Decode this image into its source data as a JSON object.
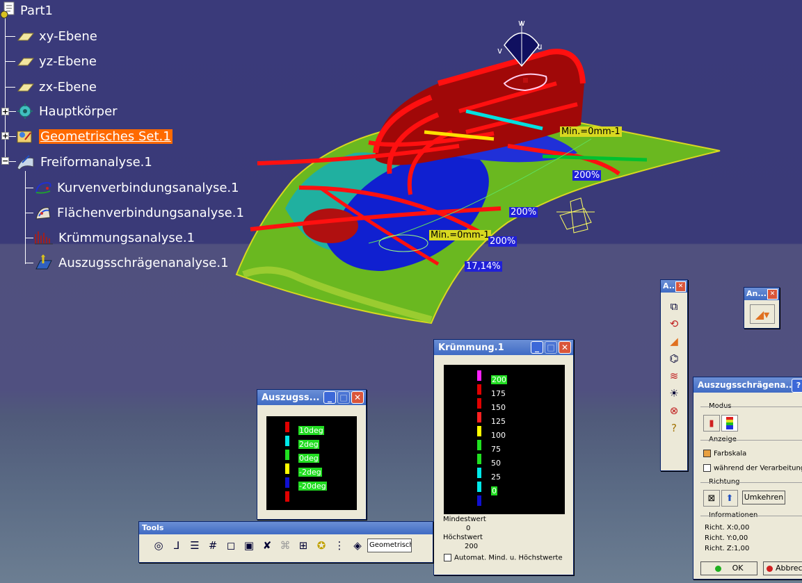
{
  "tree": {
    "root": "Part1",
    "items": [
      {
        "label": "xy-Ebene",
        "icon": "plane-icon"
      },
      {
        "label": "yz-Ebene",
        "icon": "plane-icon"
      },
      {
        "label": "zx-Ebene",
        "icon": "plane-icon"
      },
      {
        "label": "Hauptkörper",
        "icon": "body-icon"
      },
      {
        "label": "Geometrisches Set.1",
        "icon": "geometric-set-icon"
      },
      {
        "label": "Freiformanalyse.1",
        "icon": "freeform-analysis-icon"
      }
    ],
    "children": [
      {
        "label": "Kurvenverbindungsanalyse.1"
      },
      {
        "label": "Flächenverbindungsanalyse.1"
      },
      {
        "label": "Krümmungsanalyse.1"
      },
      {
        "label": "Auszugsschrägenanalyse.1"
      }
    ]
  },
  "viewport": {
    "compass": {
      "w": "w",
      "v": "v",
      "u": "u"
    },
    "labels": {
      "min1": "Min.=0mm-1",
      "min2": "Min.=0mm-1",
      "p1": "200%",
      "p2": "200%",
      "p3": "200%",
      "p4": "17,14%"
    }
  },
  "draft_window": {
    "title": "Auszugss...",
    "scale": [
      "10deg",
      "2deg",
      "0deg",
      "-2deg",
      "-20deg"
    ]
  },
  "curv_window": {
    "title": "Krümmung.1",
    "scale": [
      "200",
      "175",
      "150",
      "125",
      "100",
      "75",
      "50",
      "25",
      "0"
    ],
    "min_label": "Mindestwert",
    "min_value": "0",
    "max_label": "Höchstwert",
    "max_value": "200",
    "auto_label": "Automat. Mind. u. Höchstwerte"
  },
  "tools": {
    "title": "Tools",
    "combo_value": "Geometrisch"
  },
  "vtoolbar": {
    "title": "A..."
  },
  "an_toolbar": {
    "title": "An..."
  },
  "draft_dialog": {
    "title": "Auszugsschrägena...",
    "mode_label": "Modus",
    "display_label": "Anzeige",
    "colorscale_label": "Farbskala",
    "running_label": "während der Verarbeitung",
    "direction_label": "Richtung",
    "reverse_label": "Umkehren",
    "info_label": "Informationen",
    "dir_x": "Richt. X:0,00",
    "dir_y": "Richt. Y:0,00",
    "dir_z": "Richt. Z:1,00",
    "ok_label": "OK",
    "cancel_label": "Abbrech"
  },
  "colors": {
    "accent_select": "#ff6a00",
    "titlebar": "#3f6bc4",
    "surface_green": "#6ab820",
    "red": "#ff1010",
    "blue": "#1020d0"
  }
}
